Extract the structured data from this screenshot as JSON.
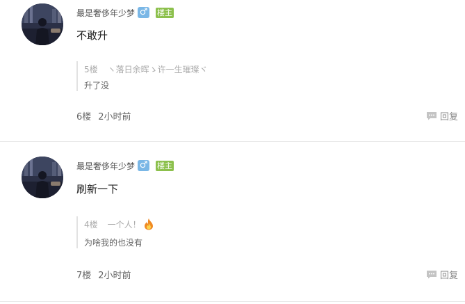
{
  "posts": [
    {
      "username": "最是奢侈年少梦",
      "gender_symbol": "♂",
      "badge": "楼主",
      "content": "不敢升",
      "quote": {
        "floor": "5楼",
        "user": "ヽ落日余晖ゝ许一生璀璨ヾ",
        "text": "升了没"
      },
      "floor": "6楼",
      "time": "2小时前",
      "reply_label": "回复"
    },
    {
      "username": "最是奢侈年少梦",
      "gender_symbol": "♂",
      "badge": "楼主",
      "content": "刷新一下",
      "quote": {
        "floor": "4楼",
        "user": "一个人！",
        "text": "为啥我的也没有"
      },
      "floor": "7楼",
      "time": "2小时前",
      "reply_label": "回复"
    }
  ],
  "colors": {
    "gender_badge": "#7ab7e6",
    "owner_badge": "#8cc04c",
    "divider": "#e8e8e8"
  },
  "icons": [
    "avatar-image",
    "male-icon",
    "fire-icon",
    "reply-icon"
  ]
}
